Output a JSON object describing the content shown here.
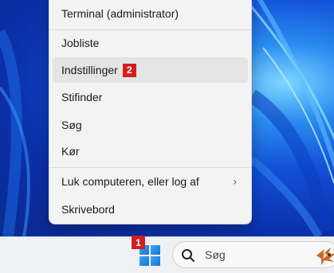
{
  "menu": {
    "items": [
      {
        "label": "Terminal (administrator)"
      },
      {
        "label": "Jobliste"
      },
      {
        "label": "Indstillinger",
        "badge": "2"
      },
      {
        "label": "Stifinder"
      },
      {
        "label": "Søg"
      },
      {
        "label": "Kør"
      },
      {
        "label": "Luk computeren, eller log af",
        "chevron": "›"
      },
      {
        "label": "Skrivebord"
      }
    ]
  },
  "taskbar": {
    "start_badge": "1",
    "search_placeholder": "Søg"
  },
  "colors": {
    "badge": "#d11f1f",
    "menu_bg": "#f3f3f3",
    "taskbar_bg": "#eef0f4",
    "windows_blue": "#1f86e8"
  },
  "icons": [
    "windows-start-icon",
    "search-icon",
    "chevron-right-icon",
    "search-highlight-icon"
  ]
}
